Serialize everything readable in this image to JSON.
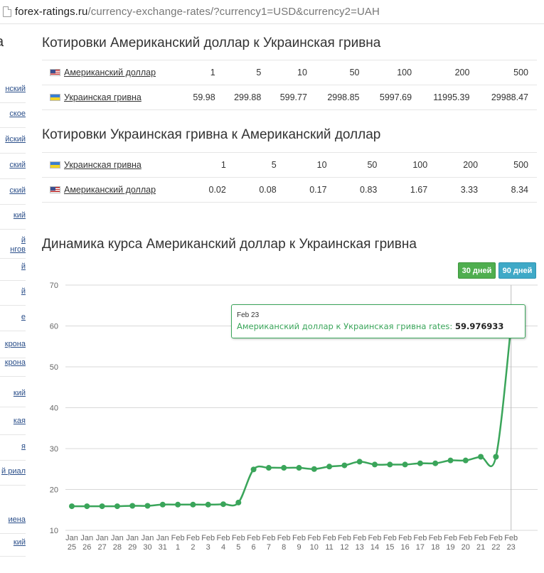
{
  "browser": {
    "url_host": "forex-ratings.ru",
    "url_path": "/currency-exchange-rates/?currency1=USD&currency2=UAH"
  },
  "sidebar": {
    "title": "a",
    "items": [
      "нский",
      "ское",
      "йский",
      "ский",
      "ский",
      "кий",
      "й\nнгов",
      "й",
      "й",
      "е",
      "крона",
      "крона",
      "кий",
      "кая",
      "я",
      "й риал",
      "иена",
      "кий"
    ]
  },
  "table1": {
    "title": "Котировки Американский доллар к Украинская гривна",
    "header": {
      "name": "Американский доллар",
      "flag": "flag-us",
      "values": [
        "1",
        "5",
        "10",
        "50",
        "100",
        "200",
        "500"
      ]
    },
    "row": {
      "name": "Украинская гривна",
      "flag": "flag-ua",
      "values": [
        "59.98",
        "299.88",
        "599.77",
        "2998.85",
        "5997.69",
        "11995.39",
        "29988.47"
      ]
    }
  },
  "table2": {
    "title": "Котировки Украинская гривна к Американский доллар",
    "header": {
      "name": "Украинская гривна",
      "flag": "flag-ua",
      "values": [
        "1",
        "5",
        "10",
        "50",
        "100",
        "200",
        "500"
      ]
    },
    "row": {
      "name": "Американский доллар",
      "flag": "flag-us",
      "values": [
        "0.02",
        "0.08",
        "0.17",
        "0.83",
        "1.67",
        "3.33",
        "8.34"
      ]
    }
  },
  "chart_section": {
    "title": "Динамика курса Американский доллар к Украинская гривна",
    "btn_30": "30 дней",
    "btn_90": "90 дней",
    "tooltip": {
      "date": "Feb 23",
      "label": "Американский доллар к Украинская гривна rates:",
      "value": "59.976933"
    }
  },
  "chart_data": {
    "type": "line",
    "title": "Динамика курса Американский доллар к Украинская гривна",
    "xlabel": "",
    "ylabel": "",
    "ylim": [
      10,
      70
    ],
    "yticks": [
      10,
      20,
      30,
      40,
      50,
      60,
      70
    ],
    "grid": true,
    "line_color": "#3aa55a",
    "categories": [
      "Jan 25",
      "Jan 26",
      "Jan 27",
      "Jan 28",
      "Jan 29",
      "Jan 30",
      "Jan 31",
      "Feb 1",
      "Feb 2",
      "Feb 3",
      "Feb 4",
      "Feb 5",
      "Feb 6",
      "Feb 7",
      "Feb 8",
      "Feb 9",
      "Feb 10",
      "Feb 11",
      "Feb 12",
      "Feb 13",
      "Feb 14",
      "Feb 15",
      "Feb 16",
      "Feb 17",
      "Feb 18",
      "Feb 19",
      "Feb 20",
      "Feb 21",
      "Feb 22",
      "Feb 23"
    ],
    "values": [
      15.9,
      15.9,
      15.9,
      15.9,
      16.0,
      16.0,
      16.3,
      16.3,
      16.3,
      16.3,
      16.4,
      16.8,
      24.9,
      25.3,
      25.3,
      25.3,
      25.0,
      25.6,
      25.9,
      26.8,
      26.1,
      26.1,
      26.1,
      26.4,
      26.4,
      27.1,
      27.1,
      28.0,
      28.0,
      59.98
    ]
  }
}
